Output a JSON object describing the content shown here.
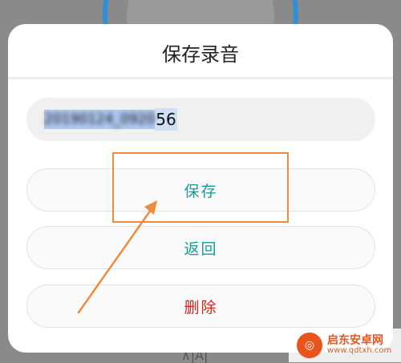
{
  "dialog": {
    "title": "保存录音",
    "filename": {
      "selected": "20190124_0920",
      "rest": "56"
    },
    "buttons": {
      "save": "保存",
      "back": "返回",
      "delete": "删除"
    }
  },
  "background": {
    "bottom_icon": "⊼|A|"
  },
  "watermark": {
    "name": "启东安卓网",
    "url": "www.qdtxh.com"
  },
  "colors": {
    "accent": "#1a9a9a",
    "danger": "#d0281d",
    "annotation": "#ef8b3a"
  }
}
